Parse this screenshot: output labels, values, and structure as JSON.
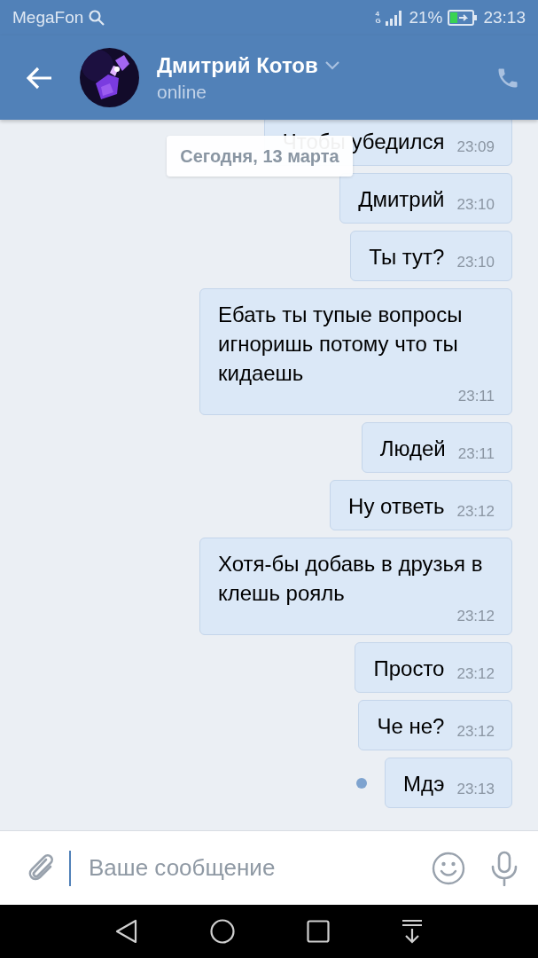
{
  "status_bar": {
    "carrier": "MegaFon",
    "network": "4G",
    "battery": "21%",
    "time": "23:13"
  },
  "header": {
    "name": "Дмитрий Котов",
    "status": "online"
  },
  "date_separator": "Сегодня, 13 марта",
  "messages": [
    {
      "text": "Чтобы убедился",
      "time": "23:09",
      "unread": false
    },
    {
      "text": "Дмитрий",
      "time": "23:10",
      "unread": false
    },
    {
      "text": "Ты тут?",
      "time": "23:10",
      "unread": false
    },
    {
      "text": "Ебать ты тупые вопросы игноришь потому что ты кидаешь",
      "time": "23:11",
      "unread": false
    },
    {
      "text": "Людей",
      "time": "23:11",
      "unread": false
    },
    {
      "text": "Ну ответь",
      "time": "23:12",
      "unread": false
    },
    {
      "text": "Хотя-бы добавь в друзья в клешь рояль",
      "time": "23:12",
      "unread": false
    },
    {
      "text": "Просто",
      "time": "23:12",
      "unread": false
    },
    {
      "text": "Че не?",
      "time": "23:12",
      "unread": false
    },
    {
      "text": "Мдэ",
      "time": "23:13",
      "unread": true
    }
  ],
  "composer": {
    "placeholder": "Ваше сообщение"
  }
}
